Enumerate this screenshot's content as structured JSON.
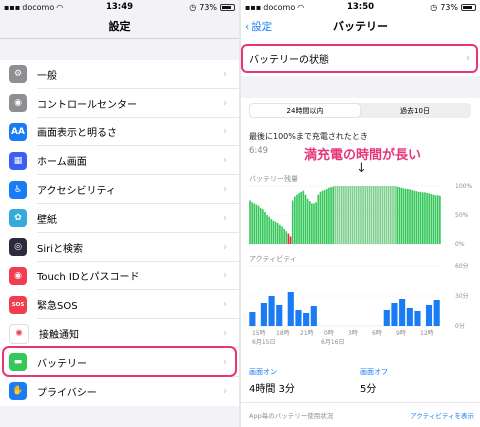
{
  "left_phone": {
    "status": {
      "carrier": "docomo",
      "time": "13:49",
      "battery": "73%"
    },
    "nav_title": "設定",
    "items": [
      {
        "label": "一般",
        "icon": "gear-icon",
        "color": "#8e8e93",
        "glyph": "⚙"
      },
      {
        "label": "コントロールセンター",
        "icon": "toggles-icon",
        "color": "#8e8e93",
        "glyph": "◉"
      },
      {
        "label": "画面表示と明るさ",
        "icon": "text-size-icon",
        "color": "#1a7cf5",
        "glyph": "AA"
      },
      {
        "label": "ホーム画面",
        "icon": "home-grid-icon",
        "color": "#3b5ef5",
        "glyph": "▦"
      },
      {
        "label": "アクセシビリティ",
        "icon": "accessibility-icon",
        "color": "#1a7cf5",
        "glyph": "♿"
      },
      {
        "label": "壁紙",
        "icon": "flower-icon",
        "color": "#34aadc",
        "glyph": "✿"
      },
      {
        "label": "Siriと検索",
        "icon": "siri-icon",
        "color": "#2b2b3d",
        "glyph": "◎"
      },
      {
        "label": "Touch IDとパスコード",
        "icon": "fingerprint-icon",
        "color": "#f23c4f",
        "glyph": "◉"
      },
      {
        "label": "緊急SOS",
        "icon": "sos-icon",
        "color": "#f23c4f",
        "glyph": "SOS"
      },
      {
        "label": "接触通知",
        "icon": "exposure-icon",
        "color": "#ffffff",
        "glyph": "✺"
      },
      {
        "label": "バッテリー",
        "icon": "battery-icon",
        "color": "#34c759",
        "glyph": "▬"
      },
      {
        "label": "プライバシー",
        "icon": "hand-icon",
        "color": "#1a7cf5",
        "glyph": "✋"
      }
    ]
  },
  "right_phone": {
    "status": {
      "carrier": "docomo",
      "time": "13:50",
      "battery": "73%"
    },
    "back_label": "設定",
    "nav_title": "バッテリー",
    "health_label": "バッテリーの状態",
    "segments": {
      "first": "24時間以内",
      "second": "過去10日"
    },
    "last_charge_label": "最後に100%まで充電されたとき",
    "last_charge_time": "6:49",
    "annotation": "満充電の時間が長い",
    "arrow": "↓",
    "battery_level_label": "バッテリー残量",
    "activity_label": "アクティビティ",
    "screen_on_label": "画面オン",
    "screen_on_value": "4時間 3分",
    "screen_off_label": "画面オフ",
    "screen_off_value": "5分",
    "usage_label": "App毎のバッテリー使用状況",
    "activity_link": "アクティビティを表示",
    "colors": {
      "accent": "#1a7cf5",
      "highlight": "#e6357a",
      "battery_green": "#34c759",
      "low_red": "#e0302a"
    }
  },
  "chart_data": [
    {
      "type": "bar",
      "title": "バッテリー残量",
      "y_ticks": [
        "100%",
        "50%",
        "0%"
      ],
      "ylim": [
        0,
        100
      ],
      "values": [
        75,
        72,
        70,
        68,
        66,
        62,
        60,
        55,
        50,
        47,
        43,
        40,
        38,
        36,
        33,
        30,
        26,
        22,
        18,
        13,
        75,
        82,
        85,
        88,
        90,
        92,
        85,
        78,
        74,
        70,
        70,
        72,
        85,
        90,
        92,
        93,
        95,
        97,
        98,
        99,
        100,
        100,
        100,
        100,
        100,
        100,
        100,
        100,
        100,
        100,
        100,
        100,
        100,
        100,
        100,
        100,
        100,
        100,
        100,
        100,
        100,
        100,
        100,
        100,
        100,
        100,
        100,
        100,
        100,
        99,
        98,
        97,
        96,
        95,
        95,
        94,
        93,
        92,
        91,
        90,
        90,
        89,
        89,
        88,
        87,
        86,
        85,
        84,
        84,
        83
      ]
    },
    {
      "type": "bar",
      "title": "アクティビティ",
      "y_ticks": [
        "60分",
        "30分",
        "0分"
      ],
      "ylim": [
        0,
        60
      ],
      "x_ticks": [
        "15時",
        "18時",
        "21時",
        "0時",
        "3時",
        "6時",
        "9時",
        "12時"
      ],
      "x_dates": [
        "6月15日",
        "6月16日"
      ],
      "values": [
        14,
        0,
        0,
        23,
        0,
        30,
        0,
        21,
        0,
        0,
        34,
        0,
        16,
        0,
        13,
        0,
        20,
        0,
        0,
        0,
        0,
        0,
        0,
        0,
        0,
        0,
        0,
        0,
        0,
        0,
        0,
        0,
        0,
        0,
        0,
        16,
        0,
        23,
        0,
        27,
        0,
        18,
        0,
        15,
        0,
        0,
        21,
        0,
        26,
        0
      ]
    }
  ]
}
